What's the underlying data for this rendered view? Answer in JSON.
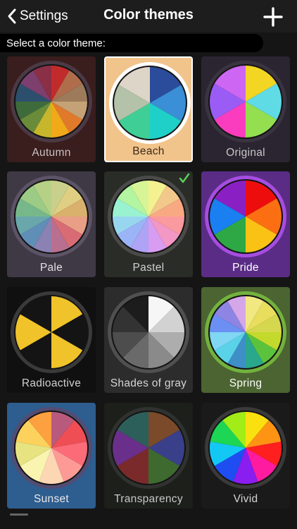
{
  "nav": {
    "back_label": "Settings",
    "title": "Color themes"
  },
  "subheader": "Select a color theme:",
  "selected_theme": "Beach",
  "checked_theme": "Pastel",
  "themes": [
    {
      "name": "Autumn",
      "bg": "#3a1d1d",
      "ring": "#4b3a45",
      "label_color": "#c9c2c2",
      "colors": [
        "#c22b2b",
        "#b06d4c",
        "#9c7a5a",
        "#c4a276",
        "#e07a2a",
        "#f0a918",
        "#c7b52c",
        "#6a8c3a",
        "#3e6b3b",
        "#2d4f6e",
        "#7d3f6e",
        "#8b2f46"
      ]
    },
    {
      "name": "Beach",
      "bg": "#f1c48c",
      "ring": "#ffffff",
      "label_color": "#3a2a1a",
      "colors": [
        "#2a4c9a",
        "#3a8fd6",
        "#1fd0c8",
        "#3fcf96",
        "#b3c2a8",
        "#ddd5c8"
      ]
    },
    {
      "name": "Original",
      "bg": "#2a2530",
      "ring": "#3a3440",
      "label_color": "#c8c8c8",
      "colors": [
        "#f3d523",
        "#5fdbe6",
        "#93df50",
        "#fa3dbf",
        "#9b5cf5",
        "#cd66f2"
      ]
    },
    {
      "name": "Pale",
      "bg": "#3f3946",
      "ring": "#5c5466",
      "label_color": "#e2e2e2",
      "colors": [
        "#c9d08c",
        "#e0cf82",
        "#d9b06c",
        "#e89f86",
        "#d96b74",
        "#b96f8f",
        "#8b81b2",
        "#5f8fb6",
        "#6aa7ad",
        "#76b88a",
        "#9ccb85",
        "#b6d185"
      ]
    },
    {
      "name": "Pastel",
      "bg": "#2a2c28",
      "ring": "#4a4a48",
      "label_color": "#d0d0d0",
      "colors": [
        "#f4f190",
        "#f3c88b",
        "#f8a982",
        "#fb9a9e",
        "#f397c4",
        "#d89cf0",
        "#aea3f5",
        "#9bb4f7",
        "#98d6f0",
        "#99f2d0",
        "#b3f5a0",
        "#d7f596"
      ]
    },
    {
      "name": "Pride",
      "bg": "#5a2c86",
      "ring": "#a64de0",
      "label_color": "#ffffff",
      "colors": [
        "#ee0d0d",
        "#fb6f12",
        "#fbc216",
        "#2ea844",
        "#1a7ff0",
        "#8a20c4"
      ]
    },
    {
      "name": "Radioactive",
      "bg": "#101010",
      "ring": "#3a3a3a",
      "label_color": "#d0d0d0",
      "colors": [
        "#f0c32a",
        "#141414",
        "#f0c32a",
        "#141414",
        "#f0c32a",
        "#141414"
      ]
    },
    {
      "name": "Shades of gray",
      "bg": "#2c2c2c",
      "ring": "#505050",
      "label_color": "#d5d5d5",
      "colors": [
        "#f6f6f6",
        "#d2d2d2",
        "#adadad",
        "#8a8a8a",
        "#6a6a6a",
        "#4d4d4d",
        "#333333",
        "#1c1c1c"
      ]
    },
    {
      "name": "Spring",
      "bg": "#4b6431",
      "ring": "#73b23e",
      "label_color": "#ffffff",
      "colors": [
        "#f1e882",
        "#e8dd5c",
        "#d5d74e",
        "#c3d92c",
        "#5bc33b",
        "#2aa88c",
        "#3d8fc6",
        "#5ad2e8",
        "#7fd7f3",
        "#6b8ff2",
        "#8e84e4",
        "#d5a6e8"
      ]
    },
    {
      "name": "Sunset",
      "bg": "#2e5d8f",
      "ring": "#534c72",
      "label_color": "#e8e8e8",
      "colors": [
        "#b85a7c",
        "#f04e55",
        "#fb6b78",
        "#fd9a96",
        "#fdd7b4",
        "#f9f4b0",
        "#e7e380",
        "#fdd25c",
        "#fda040"
      ]
    },
    {
      "name": "Transparency",
      "bg": "#1d1f1b",
      "ring": "#303230",
      "label_color": "#c8c8c8",
      "colors": [
        "#7a4a2a",
        "#3a3f8a",
        "#3e6a30",
        "#7a2a2a",
        "#6a2f8a",
        "#2d5f5a"
      ]
    },
    {
      "name": "Vivid",
      "bg": "#1a1a1a",
      "ring": "#3a3a3a",
      "label_color": "#d5d5d5",
      "colors": [
        "#fbe010",
        "#ff9414",
        "#ff1f1f",
        "#ff1ba0",
        "#8a1df0",
        "#1e4ef2",
        "#14c8f6",
        "#1dd654",
        "#a2ec17"
      ]
    }
  ]
}
